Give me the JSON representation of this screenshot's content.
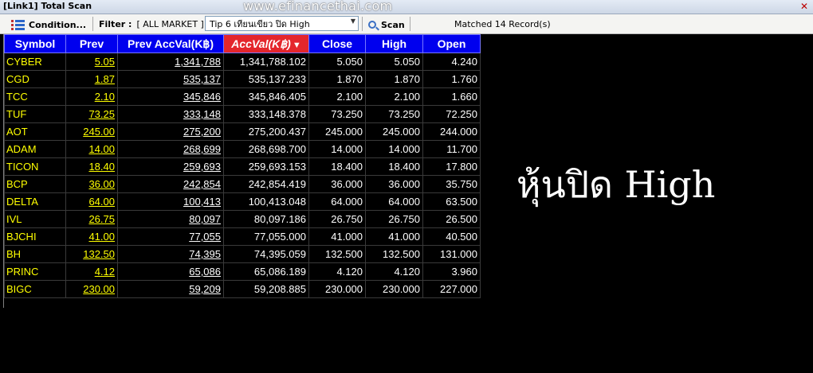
{
  "window": {
    "title": "[Link1] Total Scan",
    "watermark": "www.efinancethai.com"
  },
  "toolbar": {
    "condition_label": "Condition...",
    "filter_label": "Filter :",
    "filter_value": "[ ALL MARKET ]",
    "tip_select_value": "Tip 6 เทียนเขียว  ปิด  High",
    "scan_label": "Scan",
    "matched_text": "Matched 14 Record(s)"
  },
  "table": {
    "columns": [
      "Symbol",
      "Prev",
      "Prev AccVal(K฿)",
      "AccVal(K฿)",
      "Close",
      "High",
      "Open"
    ],
    "sorted_column": "AccVal(K฿)",
    "rows": [
      {
        "symbol": "CYBER",
        "prev": "5.05",
        "prev_accval": "1,341,788",
        "accval": "1,341,788.102",
        "close": "5.050",
        "high": "5.050",
        "open": "4.240"
      },
      {
        "symbol": "CGD",
        "prev": "1.87",
        "prev_accval": "535,137",
        "accval": "535,137.233",
        "close": "1.870",
        "high": "1.870",
        "open": "1.760"
      },
      {
        "symbol": "TCC",
        "prev": "2.10",
        "prev_accval": "345,846",
        "accval": "345,846.405",
        "close": "2.100",
        "high": "2.100",
        "open": "1.660"
      },
      {
        "symbol": "TUF",
        "prev": "73.25",
        "prev_accval": "333,148",
        "accval": "333,148.378",
        "close": "73.250",
        "high": "73.250",
        "open": "72.250"
      },
      {
        "symbol": "AOT",
        "prev": "245.00",
        "prev_accval": "275,200",
        "accval": "275,200.437",
        "close": "245.000",
        "high": "245.000",
        "open": "244.000"
      },
      {
        "symbol": "ADAM",
        "prev": "14.00",
        "prev_accval": "268,699",
        "accval": "268,698.700",
        "close": "14.000",
        "high": "14.000",
        "open": "11.700"
      },
      {
        "symbol": "TICON",
        "prev": "18.40",
        "prev_accval": "259,693",
        "accval": "259,693.153",
        "close": "18.400",
        "high": "18.400",
        "open": "17.800"
      },
      {
        "symbol": "BCP",
        "prev": "36.00",
        "prev_accval": "242,854",
        "accval": "242,854.419",
        "close": "36.000",
        "high": "36.000",
        "open": "35.750"
      },
      {
        "symbol": "DELTA",
        "prev": "64.00",
        "prev_accval": "100,413",
        "accval": "100,413.048",
        "close": "64.000",
        "high": "64.000",
        "open": "63.500"
      },
      {
        "symbol": "IVL",
        "prev": "26.75",
        "prev_accval": "80,097",
        "accval": "80,097.186",
        "close": "26.750",
        "high": "26.750",
        "open": "26.500"
      },
      {
        "symbol": "BJCHI",
        "prev": "41.00",
        "prev_accval": "77,055",
        "accval": "77,055.000",
        "close": "41.000",
        "high": "41.000",
        "open": "40.500"
      },
      {
        "symbol": "BH",
        "prev": "132.50",
        "prev_accval": "74,395",
        "accval": "74,395.059",
        "close": "132.500",
        "high": "132.500",
        "open": "131.000"
      },
      {
        "symbol": "PRINC",
        "prev": "4.12",
        "prev_accval": "65,086",
        "accval": "65,086.189",
        "close": "4.120",
        "high": "4.120",
        "open": "3.960"
      },
      {
        "symbol": "BIGC",
        "prev": "230.00",
        "prev_accval": "59,209",
        "accval": "59,208.885",
        "close": "230.000",
        "high": "230.000",
        "open": "227.000"
      }
    ]
  },
  "overlay_text": "หุ้นปิด High",
  "colors": {
    "header_bg": "#0000ee",
    "sorted_header_bg": "#e4262c",
    "symbol_text": "#ffff00",
    "background": "#000000"
  },
  "icons": {
    "condition": "condition-list-icon",
    "scan": "search-icon",
    "close": "close-icon",
    "sort": "sort-desc-icon"
  }
}
